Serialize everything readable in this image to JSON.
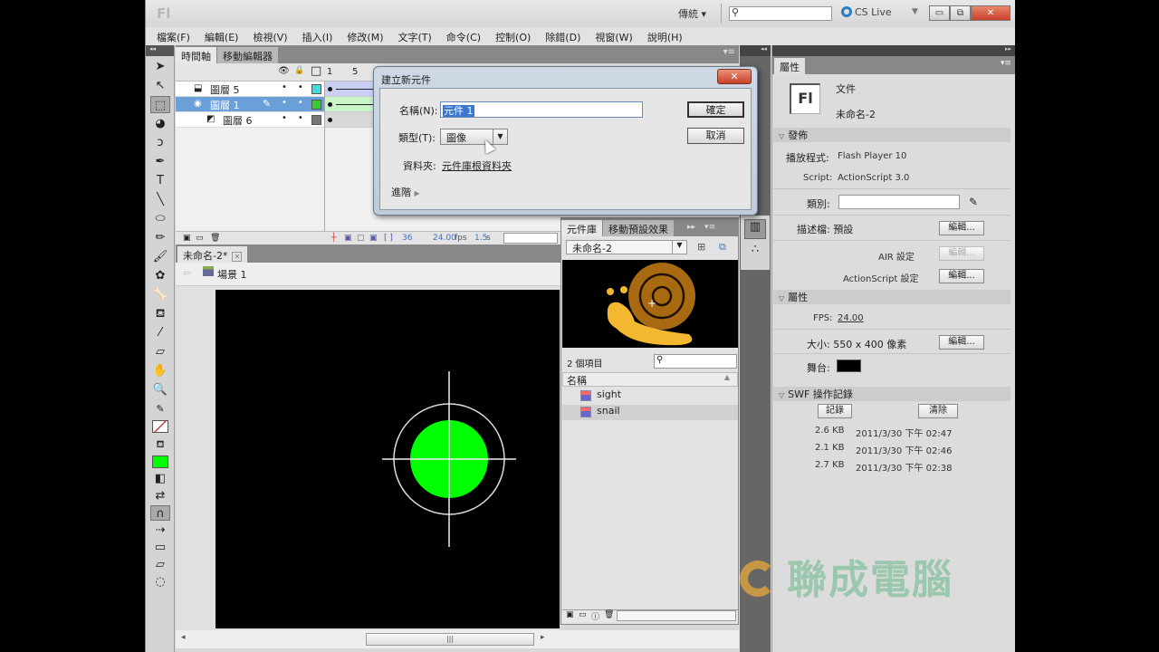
{
  "app": {
    "logo": "Fl",
    "workspace": "傳統 ▾",
    "search_placeholder": "",
    "search_icon": "⚲",
    "cs_live": "CS Live",
    "window_buttons": {
      "minimize": "▭",
      "restore": "⧉",
      "close": "✕"
    }
  },
  "menu": [
    "檔案(F)",
    "編輯(E)",
    "檢視(V)",
    "插入(I)",
    "修改(M)",
    "文字(T)",
    "命令(C)",
    "控制(O)",
    "除錯(D)",
    "視窗(W)",
    "說明(H)"
  ],
  "toolbar": {
    "collapse": "◂◂",
    "tools": [
      {
        "name": "selection-tool",
        "glyph": "➤"
      },
      {
        "name": "subselection-tool",
        "glyph": "↖"
      },
      {
        "name": "free-transform-tool",
        "glyph": "⬚"
      },
      {
        "name": "3d-rotation-tool",
        "glyph": "◕"
      },
      {
        "name": "lasso-tool",
        "glyph": "ↄ"
      },
      {
        "name": "pen-tool",
        "glyph": "✒"
      },
      {
        "name": "text-tool",
        "glyph": "T"
      },
      {
        "name": "line-tool",
        "glyph": "╲"
      },
      {
        "name": "oval-tool",
        "glyph": "⬭"
      },
      {
        "name": "pencil-tool",
        "glyph": "✏"
      },
      {
        "name": "brush-tool",
        "glyph": "🖌"
      },
      {
        "name": "deco-tool",
        "glyph": "✿"
      },
      {
        "name": "bone-tool",
        "glyph": "🦴"
      },
      {
        "name": "paint-bucket-tool",
        "glyph": "⛾"
      },
      {
        "name": "eyedropper-tool",
        "glyph": "⁄"
      },
      {
        "name": "eraser-tool",
        "glyph": "▱"
      },
      {
        "name": "hand-tool",
        "glyph": "✋"
      },
      {
        "name": "zoom-tool",
        "glyph": "🔍"
      }
    ],
    "stroke_color_label": "✎",
    "fill_color_label": "⛾",
    "fill_color": "#00ff00",
    "bottom_tools": [
      {
        "name": "black-white-icon",
        "glyph": "◧"
      },
      {
        "name": "swap-colors-icon",
        "glyph": "⇄"
      },
      {
        "name": "snap-magnet-icon",
        "glyph": "∩"
      },
      {
        "name": "smooth-icon",
        "glyph": "⇢"
      },
      {
        "name": "straighten-icon",
        "glyph": "▭"
      },
      {
        "name": "option-icon",
        "glyph": "▱"
      },
      {
        "name": "option2-icon",
        "glyph": "◌"
      }
    ]
  },
  "timeline": {
    "tabs": [
      "時間軸",
      "移動編輯器"
    ],
    "header": {
      "eye": "👁",
      "lock": "🔒",
      "outline": "□",
      "frame_1": "1",
      "frame_5": "5"
    },
    "layers": [
      {
        "name": "圖層 5",
        "icon": "⬓",
        "color": "#44dddd",
        "selected": false,
        "indent": false,
        "frame_bg": "#cccff4"
      },
      {
        "name": "圖層 1",
        "icon": "◉",
        "color": "#33cc33",
        "selected": true,
        "indent": false,
        "frame_bg": "#c8f4c8"
      },
      {
        "name": "圖層 6",
        "icon": "◩",
        "color": "#777777",
        "selected": false,
        "indent": true,
        "frame_bg": "#d8d8d8"
      }
    ],
    "footer": {
      "current_frame": "36",
      "fps": "24.00",
      "fps_unit": "fps",
      "time": "1.5",
      "time_unit": "s"
    }
  },
  "document": {
    "tab": "未命名-2*",
    "tab_close": "✕",
    "scene": "場景 1",
    "back_arrow": "⇦"
  },
  "stage": {
    "background": "#000000",
    "symbol_fill": "#00ff00",
    "crosshair_color": "#ffffff"
  },
  "library": {
    "tabs": [
      "元件庫",
      "移動預設效果"
    ],
    "document": "未命名-2",
    "count": "2 個項目",
    "search_placeholder": "",
    "column_name": "名稱",
    "items": [
      {
        "name": "sight",
        "selected": false
      },
      {
        "name": "snail",
        "selected": true
      }
    ]
  },
  "dialog": {
    "title": "建立新元件",
    "close": "✕",
    "name_label": "名稱(N):",
    "name_value": "元件 1",
    "type_label": "類型(T):",
    "type_value": "圖像",
    "folder_label": "資料夾:",
    "folder_value": "元件庫根資料夾",
    "advanced": "進階",
    "ok": "確定",
    "cancel": "取消"
  },
  "properties": {
    "tab": "屬性",
    "doc_type": "文件",
    "doc_name": "未命名-2",
    "publish": {
      "header": "發佈",
      "player_label": "播放程式:",
      "player_value": "Flash Player 10",
      "script_label": "Script:",
      "script_value": "ActionScript 3.0",
      "class_label": "類別:",
      "class_value": "",
      "profile_label": "描述檔: 預設",
      "edit": "編輯...",
      "air_label": "AIR 設定",
      "as_label": "ActionScript 設定"
    },
    "props": {
      "header": "屬性",
      "fps_label": "FPS:",
      "fps_value": "24.00",
      "size_label": "大小: 550 x 400 像素",
      "stage_label": "舞台:",
      "stage_color": "#000000"
    },
    "swf_history": {
      "header": "SWF 操作記錄",
      "log": "記錄",
      "clear": "清除",
      "entries": [
        {
          "size": "2.6 KB",
          "time": "2011/3/30 下午 02:47"
        },
        {
          "size": "2.1 KB",
          "time": "2011/3/30 下午 02:46"
        },
        {
          "size": "2.7 KB",
          "time": "2011/3/30 下午 02:38"
        }
      ]
    }
  },
  "watermark": "聯成電腦"
}
